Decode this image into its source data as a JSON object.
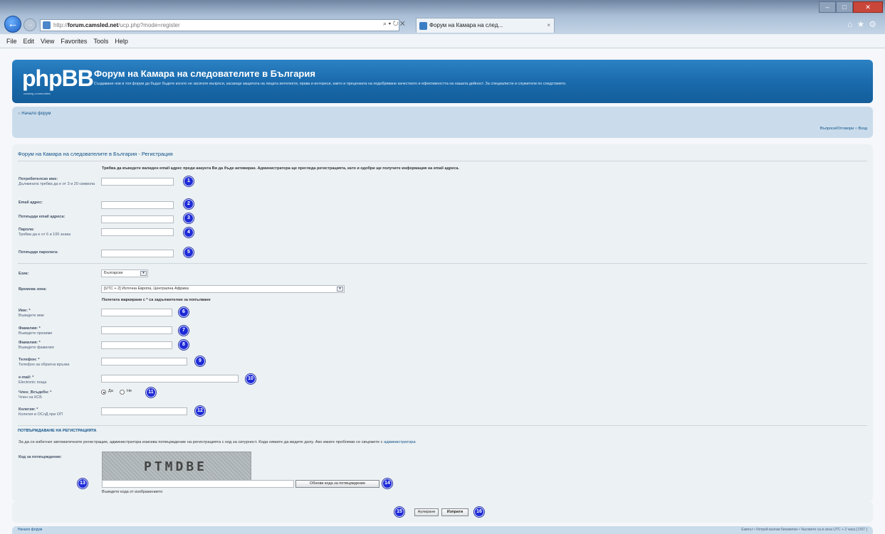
{
  "browser": {
    "address_prefix": "http://",
    "address_host": "forum.camsled.net",
    "address_path": "/ucp.php?mode=register",
    "tab_title": "Форум на Камара на след...",
    "menu": [
      "File",
      "Edit",
      "View",
      "Favorites",
      "Tools",
      "Help"
    ]
  },
  "header": {
    "logo": "phpBB",
    "logo_sub": "creating communities",
    "title": "Форум на Камара на следователите в България",
    "description": "Създаване нов в тоя форум да бъдат бъдете когато не засягате въпроси, касаещи защитата на лицата интелекти, права и интереси, както и преценката на подобряване качеството и ефективността на нашата дейност. За специалисти и служители по следствието."
  },
  "nav": {
    "breadcrumb": "Начало форум",
    "links": "Въпроси/Отговори  ○ Вход"
  },
  "panel": {
    "title": "Форум на Камара на следователите в България - Регистрация",
    "email_notice": "Трябва да въведете валиден email адрес преди акаунта Ви да бъде активиран. Администратора ще прегледа регистрацията, като и одобри ще получите информация на email адреса.",
    "fields": [
      {
        "label": "Потребителско име:",
        "explain": "Дължината трябва да е от 3 и 20 символа",
        "marker": "1"
      },
      {
        "label": "Email адрес:",
        "explain": "",
        "marker": "2"
      },
      {
        "label": "Потвърди email адреса:",
        "explain": "",
        "marker": "3"
      },
      {
        "label": "Парола:",
        "explain": "Трябва да е от 6 и 100 знака",
        "marker": "4"
      },
      {
        "label": "Потвърди паролата:",
        "explain": "",
        "marker": "5"
      }
    ],
    "language_label": "Език:",
    "language_value": "Български",
    "timezone_label": "Времева зона:",
    "timezone_value": "[UTC + 2] Източна Европа, Централна Африка",
    "required_note": "Полетата маркирани с * са задължителни за попълване",
    "profile_fields": [
      {
        "label": "Име: *",
        "explain": "Въведете име",
        "marker": "6"
      },
      {
        "label": "Фамилия: *",
        "explain": "Въведете презиме",
        "marker": "7"
      },
      {
        "label": "Фамилия: *",
        "explain": "Въведете фамилия",
        "marker": "8"
      },
      {
        "label": "Телефон: *",
        "explain": "Телефон за обратна връзка",
        "marker": "9"
      },
      {
        "label": "e-mail: *",
        "explain": "Electronic поща",
        "marker": "10"
      },
      {
        "label": "Член_Всъдебн: *",
        "explain": "Член на КСБ",
        "marker": "11"
      },
      {
        "label": "Колегия: *",
        "explain": "Колегия в ОСлД при ОП",
        "marker": "12"
      }
    ],
    "radio_yes": "Да",
    "radio_no": "Не",
    "confirm_heading": "ПОТВЪРЖДАВАНЕ НА РЕГИСТРАЦИЯТА",
    "confirm_text": "За да се избегнат автоматичните регистрации, администратора изисква потвърждение на регистрацията с код за сигурност. Кода нямате да видите долу. Ако имате проблеми се свържете с ",
    "confirm_link": "администратора",
    "confirm_code_label": "Код за потвърждение:",
    "captcha_text": "PTMDBE",
    "captcha_marker": "13",
    "refresh_button": "Обнови кода за потвърждение",
    "refresh_marker": "14",
    "captcha_help": "Въведете кода от изображението"
  },
  "submit": {
    "reset_label": "Нулиране",
    "submit_label": "Изпрати",
    "reset_marker": "15",
    "submit_marker": "16"
  },
  "footer": {
    "left": "Начало форум",
    "right": "Екипът • Изтрий всички бисквитки • Часовете са в зона UTC + 2 часа [ DST ]"
  },
  "colors": {
    "header_blue": "#1a6bad",
    "nav_blue": "#cadceb",
    "panel_bg": "#ecf1f3",
    "marker_blue": "#1e2bd8"
  }
}
